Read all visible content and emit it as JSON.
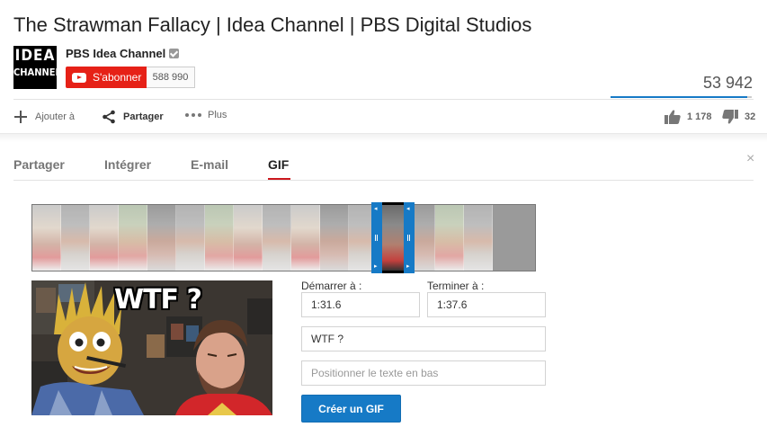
{
  "video": {
    "title": "The Strawman Fallacy | Idea Channel | PBS Digital Studios"
  },
  "channel": {
    "logo_line1": "IDEA",
    "logo_line2": "CHANNEL",
    "name": "PBS Idea Channel",
    "subscribe_label": "S'abonner",
    "subscriber_count": "588 990"
  },
  "stats": {
    "views": "53 942",
    "likes": "1 178",
    "dislikes": "32",
    "like_ratio": 0.97
  },
  "actions": {
    "add_label": "Ajouter à",
    "share_label": "Partager",
    "more_label": "Plus"
  },
  "share_panel": {
    "tabs": [
      {
        "label": "Partager",
        "active": false
      },
      {
        "label": "Intégrer",
        "active": false
      },
      {
        "label": "E-mail",
        "active": false
      },
      {
        "label": "GIF",
        "active": true
      }
    ],
    "close_glyph": "×"
  },
  "gif": {
    "preview_caption": "WTF ?",
    "start_label": "Démarrer à :",
    "start_value": "1:31.6",
    "end_label": "Terminer à :",
    "end_value": "1:37.6",
    "top_text_value": "WTF ?",
    "bottom_text_placeholder": "Positionner le texte en bas",
    "create_button": "Créer un GIF"
  },
  "colors": {
    "accent_blue": "#167ac6",
    "youtube_red": "#e62117",
    "tab_underline": "#cc181e"
  },
  "icons": [
    "verified-icon",
    "youtube-icon",
    "plus-icon",
    "share-icon",
    "more-icon",
    "like-icon",
    "dislike-icon",
    "close-icon"
  ]
}
